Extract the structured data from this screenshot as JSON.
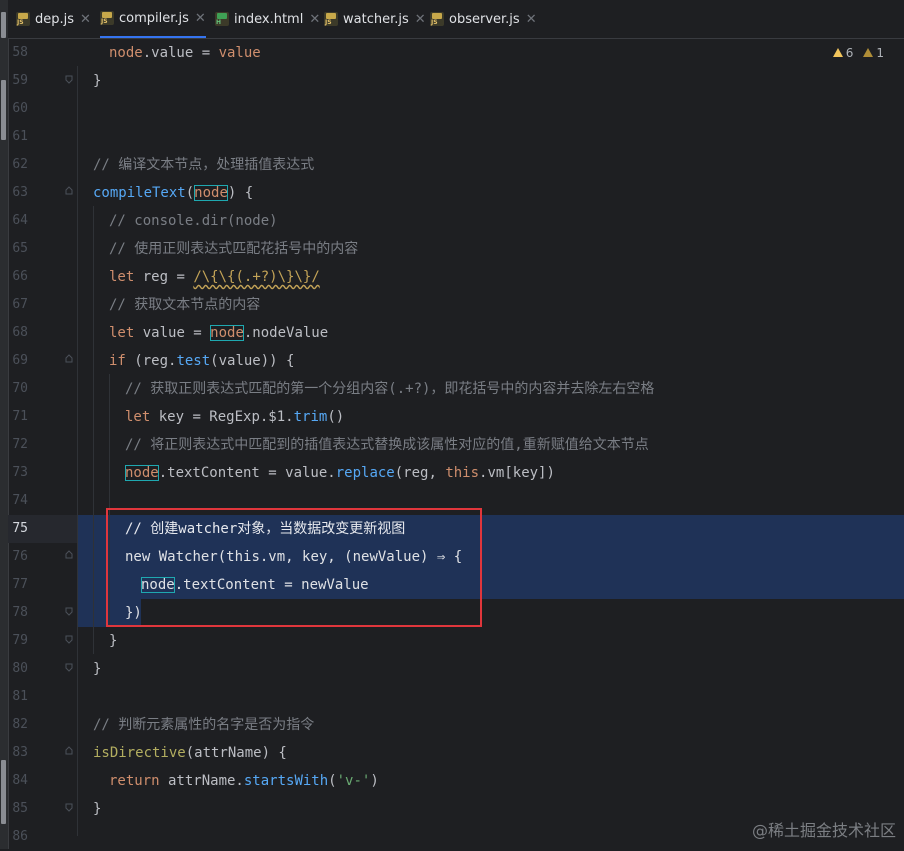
{
  "tabs": [
    {
      "label": "dep.js",
      "icon": "js-file-icon",
      "active": false
    },
    {
      "label": "compiler.js",
      "icon": "js-file-icon",
      "active": true
    },
    {
      "label": "index.html",
      "icon": "html-file-icon",
      "active": false
    },
    {
      "label": "watcher.js",
      "icon": "js-file-icon",
      "active": false
    },
    {
      "label": "observer.js",
      "icon": "js-file-icon",
      "active": false
    }
  ],
  "inspections": {
    "warnings": "6",
    "weak_warnings": "1"
  },
  "current_line": "75",
  "gutter": [
    "58",
    "59",
    "60",
    "61",
    "62",
    "63",
    "64",
    "65",
    "66",
    "67",
    "68",
    "69",
    "70",
    "71",
    "72",
    "73",
    "74",
    "75",
    "76",
    "77",
    "78",
    "79",
    "80",
    "81",
    "82",
    "83",
    "84",
    "85",
    "86"
  ],
  "code": {
    "l58": {
      "obj": "node",
      "prop": ".value = ",
      "val": "value"
    },
    "l59": "}",
    "l62": "// 编译文本节点，处理插值表达式",
    "l63": {
      "fn": "compileText",
      "open": "(",
      "param": "node",
      "close": ") {"
    },
    "l64": "// console.dir(node)",
    "l65": "// 使用正则表达式匹配花括号中的内容",
    "l66": {
      "kw": "let",
      "rest": " reg = ",
      "regex": "/\\{\\{(.+?)\\}\\}/"
    },
    "l67": "// 获取文本节点的内容",
    "l68": {
      "kw": "let",
      "rest": " value = ",
      "node": "node",
      "tail": ".nodeValue"
    },
    "l69": {
      "kw": "if",
      "a": " (reg.",
      "fn": "test",
      "b": "(value)) {"
    },
    "l70": "// 获取正则表达式匹配的第一个分组内容(.+?)，即花括号中的内容并去除左右空格",
    "l71": {
      "kw": "let",
      "a": " key = RegExp.$1.",
      "fn": "trim",
      "b": "()"
    },
    "l72": "// 将正则表达式中匹配到的插值表达式替换成该属性对应的值,重新赋值给文本节点",
    "l73": {
      "node": "node",
      "a": ".textContent = value.",
      "fn": "replace",
      "b": "(reg, ",
      "this": "this",
      "c": ".vm[key])"
    },
    "l75": "// 创建watcher对象，当数据改变更新视图",
    "l76": {
      "kw": "new",
      "a": " Watcher(this.vm, key, (newValue) ⇒ {"
    },
    "l77": {
      "node": "node",
      "a": ".textContent = newValue"
    },
    "l78": "})",
    "l79": "}",
    "l80": "}",
    "l82": "// 判断元素属性的名字是否为指令",
    "l83": {
      "fn": "isDirective",
      "a": "(attrName) {"
    },
    "l84": {
      "kw": "return",
      "a": " attrName.",
      "fn": "startsWith",
      "str": "'v-'",
      "b": ")"
    },
    "l85": "}"
  },
  "watermark": "@稀土掘金技术社区",
  "colors": {
    "keyword": "#cf8e6d",
    "function": "#56a8f5",
    "comment": "#7a7e85",
    "string": "#6aab73",
    "annotation_box": "#e0363c",
    "selection": "#214283"
  }
}
